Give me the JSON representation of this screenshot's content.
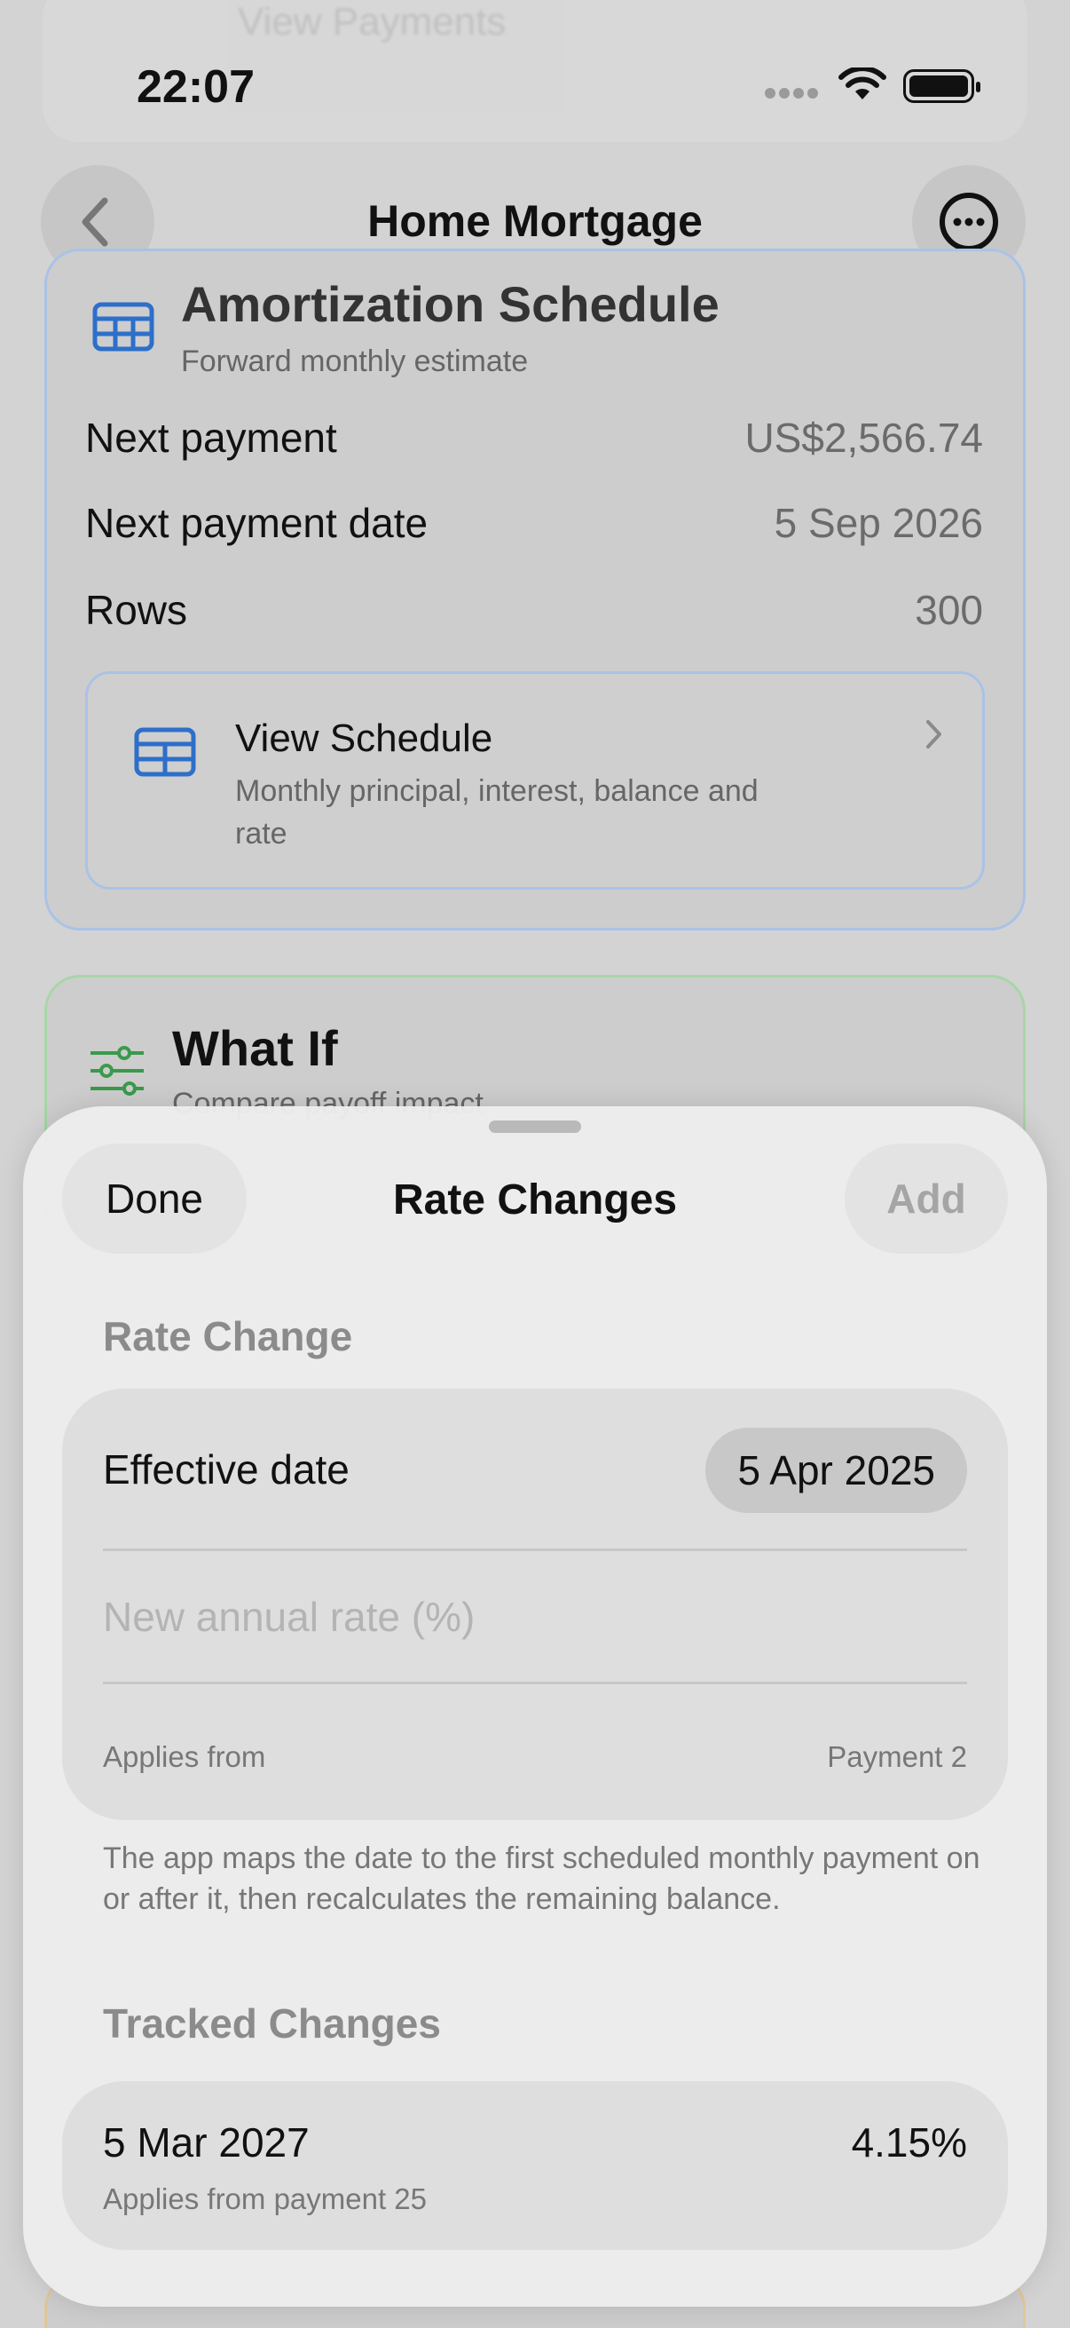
{
  "status_bar": {
    "time": "22:07"
  },
  "background": {
    "ghost_top_text": "View Payments",
    "nav": {
      "title": "Home Mortgage"
    },
    "amortization": {
      "title": "Amortization Schedule",
      "subtitle": "Forward monthly estimate",
      "rows": [
        {
          "label": "Next payment",
          "value": "US$2,566.74"
        },
        {
          "label": "Next payment date",
          "value": "5 Sep 2026"
        },
        {
          "label": "Rows",
          "value": "300"
        }
      ],
      "view_schedule": {
        "title": "View Schedule",
        "subtitle": "Monthly principal, interest, balance and rate"
      }
    },
    "what_if": {
      "title": "What If",
      "subtitle": "Compare payoff impact"
    }
  },
  "sheet": {
    "done_label": "Done",
    "title": "Rate Changes",
    "add_label": "Add",
    "rate_change_header": "Rate Change",
    "effective_date_label": "Effective date",
    "effective_date_value": "5 Apr 2025",
    "new_rate_placeholder": "New annual rate (%)",
    "applies_from_label": "Applies from",
    "applies_from_value": "Payment 2",
    "footnote": "The app maps the date to the first scheduled monthly payment on or after it, then recalculates the remaining balance.",
    "tracked_header": "Tracked Changes",
    "tracked": [
      {
        "date": "5 Mar 2027",
        "subtitle": "Applies from payment 25",
        "rate": "4.15%"
      }
    ]
  },
  "colors": {
    "accent_blue": "#1f6fd6",
    "accent_green": "#3a9a4c"
  }
}
